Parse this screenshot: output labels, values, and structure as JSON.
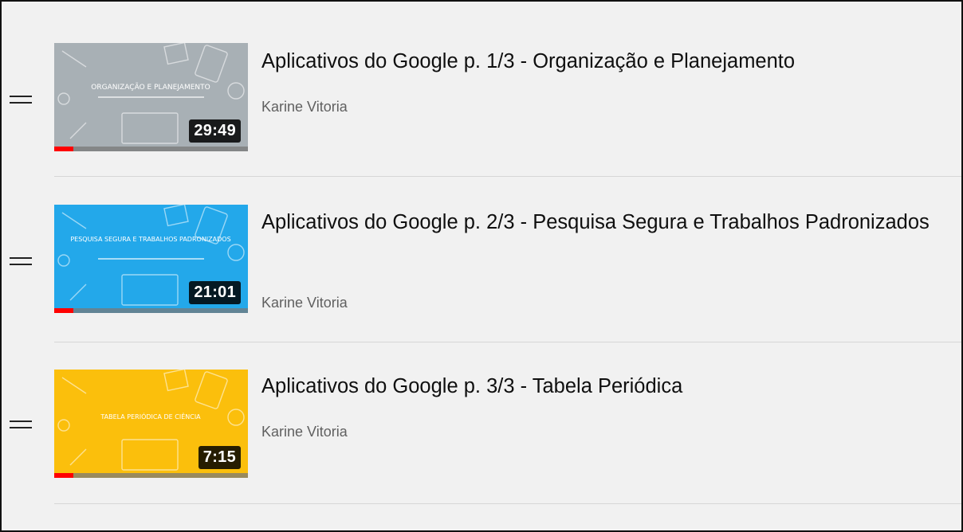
{
  "playlist": {
    "items": [
      {
        "title": "Aplicativos do Google p. 1/3 - Organização e Planejamento",
        "channel": "Karine Vitoria",
        "duration": "29:49",
        "thumb_color": "#a8b0b5",
        "thumb_heading": "ORGANIZAÇÃO E PLANEJAMENTO",
        "watched_fraction": 0.1
      },
      {
        "title": "Aplicativos do Google p. 2/3 - Pesquisa Segura e Trabalhos Padronizados",
        "channel": "Karine Vitoria",
        "duration": "21:01",
        "thumb_color": "#23a8ea",
        "thumb_heading": "PESQUISA SEGURA E TRABALHOS PADRONIZADOS",
        "watched_fraction": 0.1
      },
      {
        "title": "Aplicativos do Google p. 3/3 - Tabela Periódica",
        "channel": "Karine Vitoria",
        "duration": "7:15",
        "thumb_color": "#fbbf0c",
        "thumb_heading": "TABELA PERIÓDICA DE CIÊNCIA",
        "watched_fraction": 0.1
      }
    ]
  },
  "colors": {
    "background": "#f1f1f1",
    "progress": "#ff0000",
    "title_text": "#0f0f0f",
    "channel_text": "#606060"
  }
}
